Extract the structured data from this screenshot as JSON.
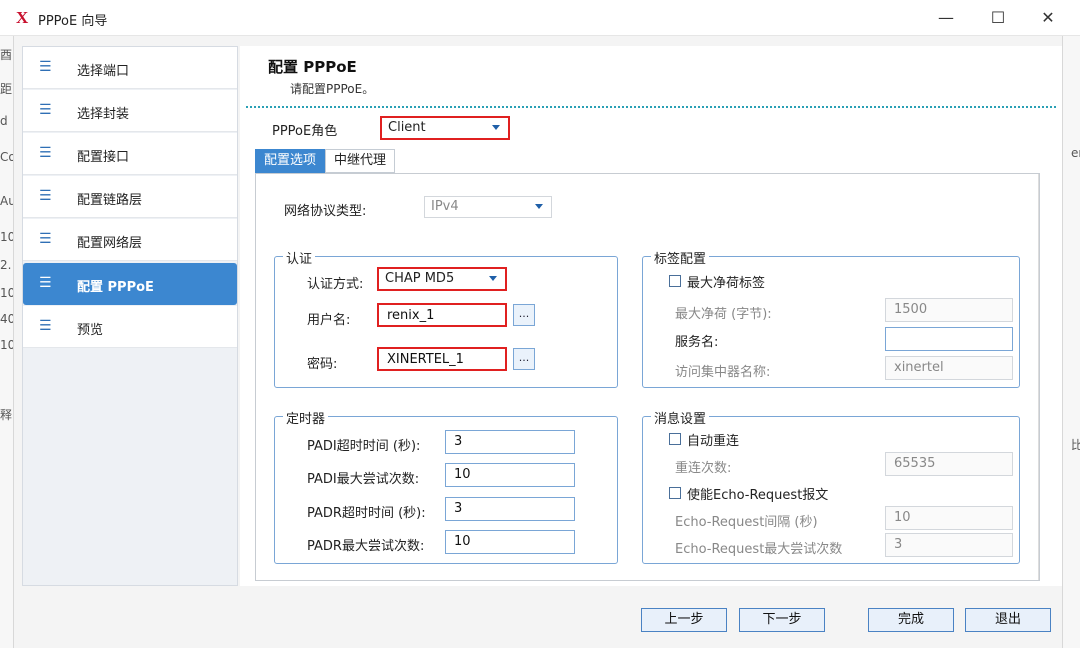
{
  "window": {
    "title": "PPPoE 向导",
    "logo": "X",
    "min_glyph": "—",
    "max_glyph": "☐",
    "close_glyph": "✕"
  },
  "bg_left": [
    "酉",
    "距",
    "d",
    "Co",
    "Au",
    "10",
    "2.",
    "10",
    "40",
    "10",
    "释"
  ],
  "bg_right": [
    "er",
    "比"
  ],
  "sidebar": {
    "items": [
      {
        "label": "选择端口"
      },
      {
        "label": "选择封装"
      },
      {
        "label": "配置接口"
      },
      {
        "label": "配置链路层"
      },
      {
        "label": "配置网络层"
      },
      {
        "label": "配置 PPPoE"
      },
      {
        "label": "预览"
      }
    ],
    "active_index": 5,
    "icon_glyph": "☰"
  },
  "main": {
    "title": "配置 PPPoE",
    "subtitle": "请配置PPPoE。",
    "role_label": "PPPoE角色",
    "role_value": "Client",
    "tabs": [
      {
        "label": "配置选项"
      },
      {
        "label": "中继代理"
      }
    ],
    "protocol_label": "网络协议类型:",
    "protocol_value": "IPv4",
    "auth": {
      "title": "认证",
      "method_label": "认证方式:",
      "method_value": "CHAP MD5",
      "user_label": "用户名:",
      "user_value": "renix_1",
      "pass_label": "密码:",
      "pass_value": "XINERTEL_1",
      "dots": "..."
    },
    "tag": {
      "title": "标签配置",
      "max_payload_tag": "最大净荷标签",
      "max_payload_label": "最大净荷 (字节):",
      "max_payload_value": "1500",
      "service_label": "服务名:",
      "service_value": "",
      "ac_label": "访问集中器名称:",
      "ac_value": "xinertel"
    },
    "timer": {
      "title": "定时器",
      "rows": [
        {
          "label": "PADI超时时间 (秒):",
          "value": "3"
        },
        {
          "label": "PADI最大尝试次数:",
          "value": "10"
        },
        {
          "label": "PADR超时时间 (秒):",
          "value": "3"
        },
        {
          "label": "PADR最大尝试次数:",
          "value": "10"
        }
      ]
    },
    "msg": {
      "title": "消息设置",
      "auto_reconnect": "自动重连",
      "reconnect_label": "重连次数:",
      "reconnect_value": "65535",
      "echo_enable": "使能Echo-Request报文",
      "echo_interval_label": "Echo-Request间隔 (秒)",
      "echo_interval_value": "10",
      "echo_max_label": "Echo-Request最大尝试次数",
      "echo_max_value": "3"
    }
  },
  "footer": {
    "prev": "上一步",
    "next": "下一步",
    "finish": "完成",
    "exit": "退出"
  },
  "scroll": {
    "up": "▲",
    "down": "▼",
    "grip": "≡"
  },
  "colors": {
    "accent": "#3c87d0",
    "highlight": "#e02020",
    "logo": "#c8102e"
  }
}
